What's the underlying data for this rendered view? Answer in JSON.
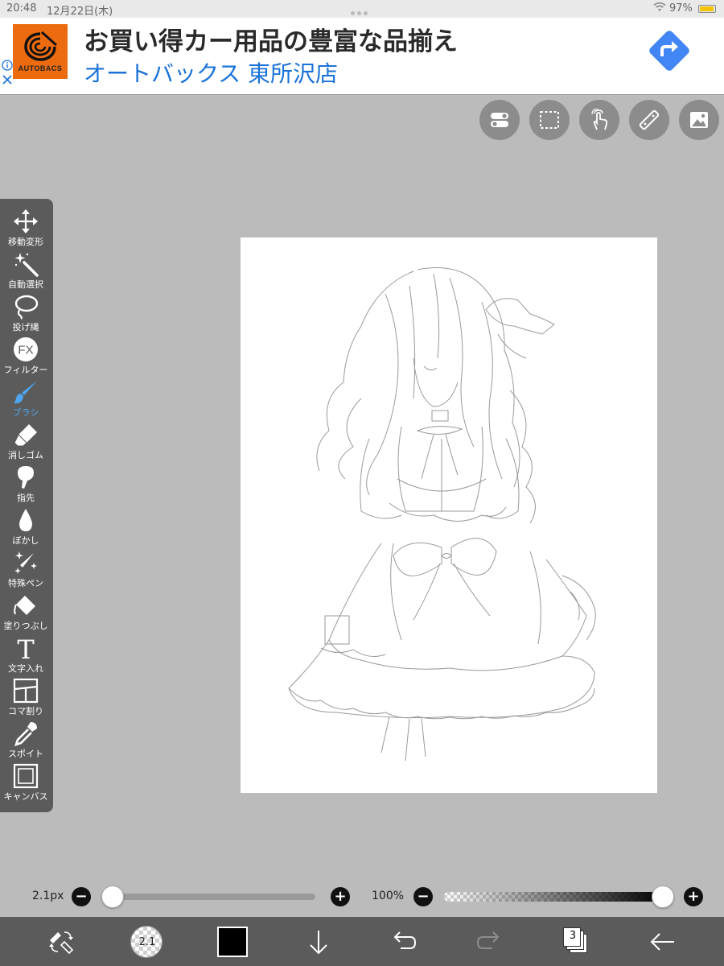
{
  "status_bar": {
    "time": "20:48",
    "date": "12月22日(木)",
    "battery_percent_label": "97%",
    "battery_level": 0.97
  },
  "ad": {
    "brand": "AUTOBACS",
    "headline": "お買い得カー用品の豊富な品揃え",
    "subline": "オートバックス 東所沢店",
    "brand_color": "#ec6b0e",
    "link_color": "#1a73d9",
    "action_color": "#4285f4"
  },
  "top_tools": [
    {
      "name": "toggle",
      "icon": "toggle-icon"
    },
    {
      "name": "selection",
      "icon": "selection-icon"
    },
    {
      "name": "gesture",
      "icon": "touch-icon"
    },
    {
      "name": "ruler",
      "icon": "ruler-icon"
    },
    {
      "name": "material",
      "icon": "image-icon"
    }
  ],
  "tools": [
    {
      "label": "移動変形",
      "icon": "move-icon"
    },
    {
      "label": "自動選択",
      "icon": "magic-wand-icon"
    },
    {
      "label": "投げ縄",
      "icon": "lasso-icon"
    },
    {
      "label": "フィルター",
      "icon": "fx-icon"
    },
    {
      "label": "ブラシ",
      "icon": "brush-icon",
      "active": true
    },
    {
      "label": "消しゴム",
      "icon": "eraser-icon"
    },
    {
      "label": "指先",
      "icon": "finger-icon"
    },
    {
      "label": "ぼかし",
      "icon": "blur-drop-icon"
    },
    {
      "label": "特殊ペン",
      "icon": "sparkle-pen-icon"
    },
    {
      "label": "塗りつぶし",
      "icon": "fill-bucket-icon"
    },
    {
      "label": "文字入れ",
      "icon": "text-icon"
    },
    {
      "label": "コマ割り",
      "icon": "panel-split-icon"
    },
    {
      "label": "スポイト",
      "icon": "eyedropper-icon"
    },
    {
      "label": "キャンバス",
      "icon": "canvas-icon"
    }
  ],
  "fx_glyph": "FX",
  "text_glyph": "T",
  "sliders": {
    "brush_size": {
      "label": "2.1px",
      "level": 0.0
    },
    "opacity": {
      "label": "100%",
      "level": 1.0
    },
    "minus": "−",
    "plus": "+"
  },
  "bottom_bar": {
    "brush_preview_label": "2.1",
    "current_color": "#000000",
    "layer_count": "3"
  },
  "accent_color": "#4ea6f0"
}
